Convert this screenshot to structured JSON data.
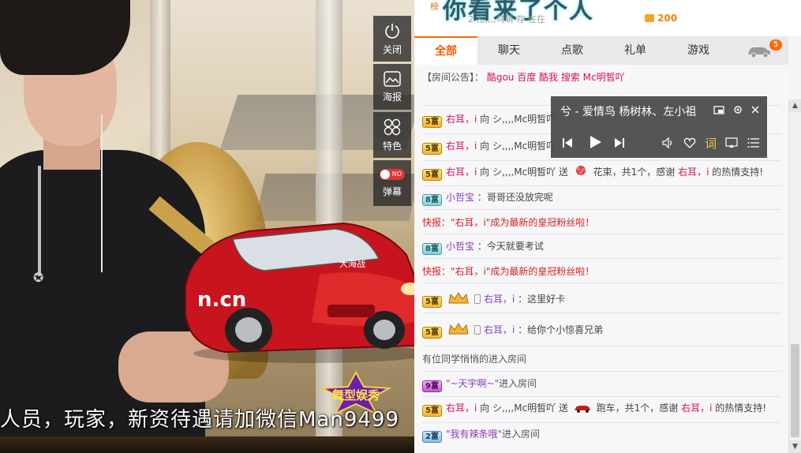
{
  "video": {
    "marquee_text": "人员，玩家，新资待遇请加微信Man9499",
    "logo_text": "舞型娱秀",
    "car_brand_text": "n.cn",
    "car_logo_text": "大海战"
  },
  "side_tools": [
    {
      "label": "关闭",
      "icon": "power-icon"
    },
    {
      "label": "海报",
      "icon": "image-icon"
    },
    {
      "label": "特色",
      "icon": "flower-icon"
    },
    {
      "label": "弹幕",
      "icon": "toggle-icon",
      "toggle_text": "NO"
    }
  ],
  "banner": {
    "rank_prefix": "榜",
    "welcome": "你看来了个人",
    "rank_text": "2  ん,,,,乌萌-存 在在",
    "coins": "200"
  },
  "tabs": [
    {
      "label": "全部",
      "active": true
    },
    {
      "label": "聊天",
      "active": false
    },
    {
      "label": "点歌",
      "active": false
    },
    {
      "label": "礼单",
      "active": false
    },
    {
      "label": "游戏",
      "active": false
    }
  ],
  "car_tab_badge": "5",
  "notice": {
    "label": "【房间公告】：",
    "text": "酷gou 百度 酷我 搜索 Mc明皙吖"
  },
  "chat": [
    {
      "level": "5富",
      "color": "gold",
      "user": "右耳，i",
      "text": "向 シ,,,,Mc明皙吖"
    },
    {
      "level": "5富",
      "color": "gold",
      "user": "右耳，i",
      "text": "向 シ,,,,Mc明皙吖"
    },
    {
      "level": "5富",
      "color": "gold",
      "user": "右耳，i",
      "text": "向 シ,,,,Mc明皙吖 送",
      "gift": "花束，共1个，感谢",
      "thanks_user": "右耳，i",
      "tail": "的热情支持!"
    },
    {
      "level": "8富",
      "color": "teal",
      "user": "小哲宝",
      "text": "：哥哥还没放完呢"
    },
    {
      "flash": "快报：\"右耳，i\"成为最新的皇冠粉丝啦！"
    },
    {
      "level": "8富",
      "color": "teal",
      "user": "小哲宝",
      "text": "：今天就要考试"
    },
    {
      "flash": "快报：\"右耳，i\"成为最新的皇冠粉丝啦！"
    },
    {
      "level": "5富",
      "color": "gold",
      "user": "右耳，i",
      "text": "：这里好卡"
    },
    {
      "level": "5富",
      "color": "gold",
      "user": "右耳，i",
      "text": "：给你个小惊喜兄弟"
    },
    {
      "plain": "有位同学悄悄的进入房间"
    },
    {
      "level": "9富",
      "color": "purple",
      "user": "\"~天宇啊~\"",
      "text": "进入房间"
    },
    {
      "level": "5富",
      "color": "gold",
      "user": "右耳，i",
      "text": "向 シ,,,,Mc明皙吖 送",
      "gift": "跑车，共1个，感谢",
      "thanks_user": "右耳，i",
      "tail": "的热情支持!"
    },
    {
      "level": "2富",
      "color": "blue",
      "user": "\"我有辣条哦\"",
      "text": "进入房间"
    }
  ],
  "player": {
    "title": "兮 - 爱情鸟    杨树林、左小祖",
    "lyrics_label": "词"
  }
}
